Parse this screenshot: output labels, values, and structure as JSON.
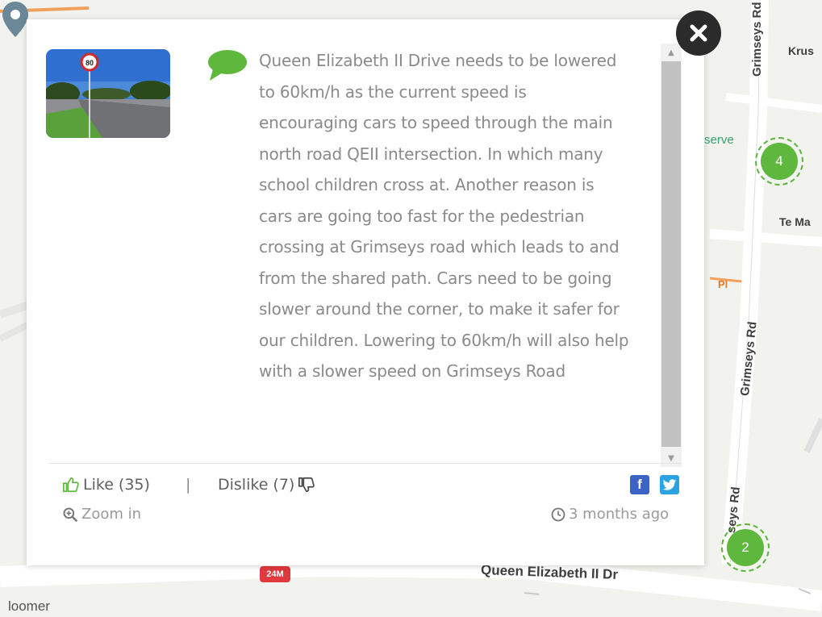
{
  "map": {
    "street_labels": {
      "grimseys_top": "Grimseys Rd",
      "krus": "Krus",
      "reserve": "serve",
      "te_ma": "Te Ma",
      "pl": "Pl",
      "grimseys_mid": "Grimseys Rd",
      "grimseys_low": "seys Rd",
      "qeii": "Queen Elizabeth II Dr",
      "bloomer": "loomer",
      "shield": "24M"
    },
    "clusters": [
      {
        "count": "4"
      },
      {
        "count": "2"
      }
    ],
    "colors": {
      "cluster": "#5fb83e",
      "road_label": "#3f3f3f",
      "park_label": "#36a36a"
    },
    "icons": [
      "map-pin-icon"
    ]
  },
  "popup": {
    "thumbnail_alt": "Speed sign photo",
    "speed_sign_text": "80",
    "comment": "Queen Elizabeth II Drive needs to be lowered to 60km/h as the current speed is encouraging cars to speed through the main north road QEII intersection. In which many school children cross at. Another reason is cars are going too fast for the pedestrian crossing at Grimseys road which leads to and from the shared path. Cars need to be going slower around the corner, to make it safer for our children. Lowering to 60km/h will also help with a slower speed on Grimseys Road",
    "like_label": "Like (35)",
    "separator": "|",
    "dislike_label": "Dislike (7)",
    "zoom_label": "Zoom in",
    "time_label": "3 months ago",
    "facebook_glyph": "f",
    "colors": {
      "comment_text": "#8a8a8a",
      "bubble": "#5fb83e",
      "like_icon": "#5fb83e",
      "facebook": "#3b63c5",
      "twitter": "#2aa3e0"
    }
  }
}
